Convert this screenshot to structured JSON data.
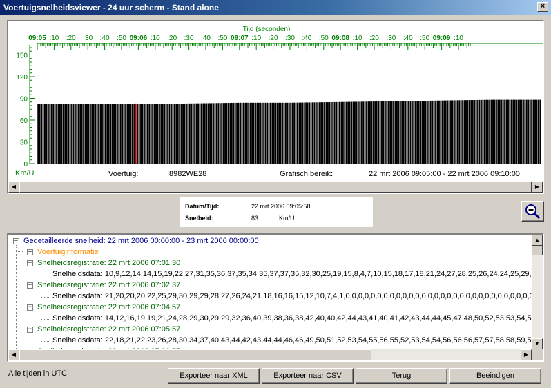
{
  "window": {
    "title": "Voertuigsnelheidsviewer - 24 uur scherm - Stand alone"
  },
  "chart": {
    "x_axis_title": "Tijd (seconden)",
    "time_labels": [
      "09:05",
      ":10",
      ":20",
      ":30",
      ":40",
      ":50",
      "09:06",
      ":10",
      ":20",
      ":30",
      ":40",
      ":50",
      "09:07",
      ":10",
      ":20",
      ":30",
      ":40",
      ":50",
      "09:08",
      ":10",
      ":20",
      ":30",
      ":40",
      ":50",
      "09:09",
      ":10"
    ],
    "y_ticks": [
      "150",
      "120",
      "90",
      "60",
      "30",
      "0"
    ],
    "unit_label": "Km/U",
    "vehicle_label": "Voertuig:",
    "vehicle_value": "8982WE28",
    "range_label": "Grafisch bereik:",
    "range_value": "22 mrt 2006 09:05:00 - 22 mrt 2006 09:10:00",
    "colors": {
      "bar": "#000000",
      "selected_bar": "#c00000",
      "axis": "#008000",
      "tick_label": "#008000"
    }
  },
  "chart_data": {
    "type": "bar",
    "title": "",
    "xlabel": "Tijd (seconden)",
    "ylabel": "Km/U",
    "ylim": [
      0,
      160
    ],
    "x_range": [
      "09:05:00",
      "09:10:00"
    ],
    "selected": {
      "time": "09:05:58",
      "value": 83
    },
    "series_profile": [
      {
        "time": "09:05:00",
        "value": 82
      },
      {
        "time": "09:05:30",
        "value": 82
      },
      {
        "time": "09:06:00",
        "value": 82
      },
      {
        "time": "09:06:30",
        "value": 83
      },
      {
        "time": "09:07:00",
        "value": 84
      },
      {
        "time": "09:07:30",
        "value": 84
      },
      {
        "time": "09:08:00",
        "value": 85
      },
      {
        "time": "09:08:30",
        "value": 86
      },
      {
        "time": "09:09:00",
        "value": 87
      },
      {
        "time": "09:09:30",
        "value": 88
      },
      {
        "time": "09:10:00",
        "value": 88
      }
    ]
  },
  "info": {
    "datetime_label": "Datum/Tijd:",
    "datetime_value": "22 mrt 2006 09:05:58",
    "speed_label": "Snelheid:",
    "speed_value": "83",
    "speed_unit": "Km/U"
  },
  "tree": {
    "root": "Gedetailleerde snelheid: 22 mrt 2006 00:00:00 - 23 mrt 2006 00:00:00",
    "vehicle_info": "Voertuiginformatie",
    "registrations": [
      {
        "title": "Snelheidsregistratie: 22 mrt 2006 07:01:30",
        "data": "Snelheidsdata: 10,9,12,14,14,15,19,22,27,31,35,36,37,35,34,35,37,37,35,32,30,25,19,15,8,4,7,10,15,18,17,18,21,24,27,28,25,26,24,24,25,29,32,"
      },
      {
        "title": "Snelheidsregistratie: 22 mrt 2006 07:02:37",
        "data": "Snelheidsdata: 21,20,20,20,22,25,29,30,29,29,28,27,26,24,21,18,16,16,15,12,10,7,4,1,0,0,0,0,0,0,0,0,0,0,0,0,0,0,0,0,0,0,0,0,0,0,0,0,0,0,0,0,0,0,0,0,0,0,0,"
      },
      {
        "title": "Snelheidsregistratie: 22 mrt 2006 07:04:57",
        "data": "Snelheidsdata: 14,12,16,19,19,21,24,28,29,30,29,29,32,36,40,39,38,36,38,42,40,40,42,44,43,41,40,41,42,43,44,44,45,47,48,50,52,53,53,54,52,5"
      },
      {
        "title": "Snelheidsregistratie: 22 mrt 2006 07:05:57",
        "data": "Snelheidsdata: 22,18,21,22,23,26,28,30,34,37,40,43,44,42,43,44,44,46,46,49,50,51,52,53,54,55,56,55,52,53,54,54,56,56,56,57,57,58,58,59,59,5"
      },
      {
        "title": "Snelheidsregistratie: 22 mrt 2006 07:06:57"
      }
    ]
  },
  "footer": {
    "utc_note": "Alle tijden in UTC",
    "btn_xml": "Exporteer naar XML",
    "btn_csv": "Exporteer naar CSV",
    "btn_back": "Terug",
    "btn_end": "Beeindigen"
  }
}
